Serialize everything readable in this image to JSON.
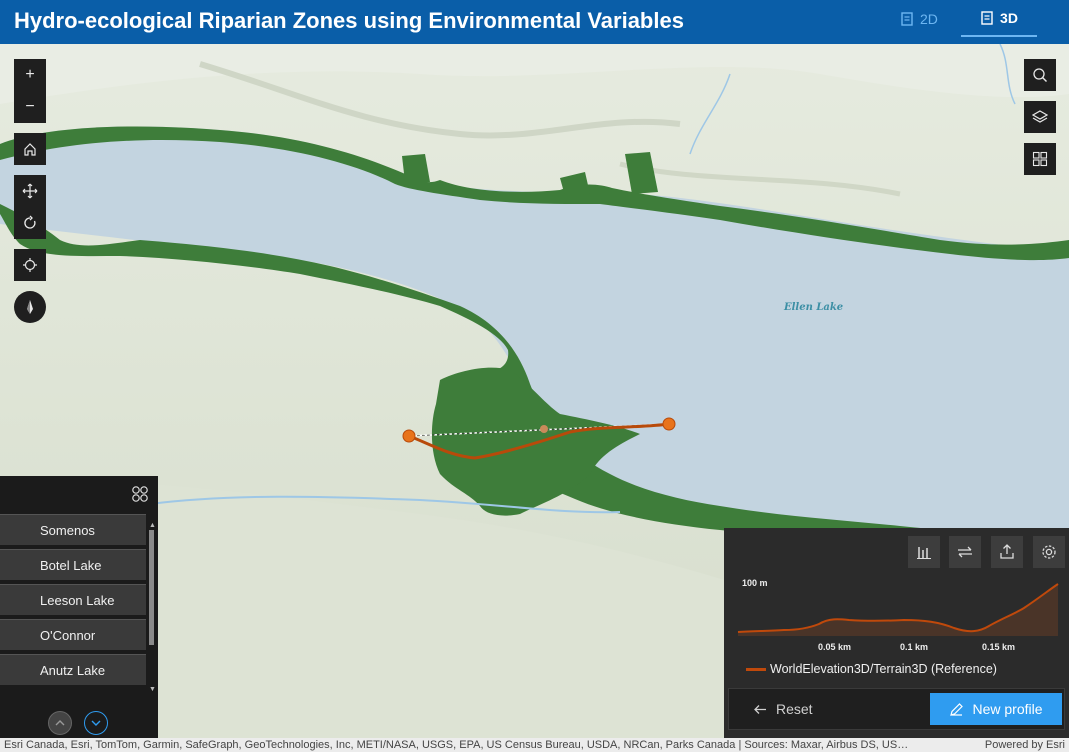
{
  "header": {
    "title": "Hydro-ecological Riparian Zones using Environmental Variables",
    "tabs": [
      {
        "label": "2D",
        "icon": "document-icon",
        "active": false
      },
      {
        "label": "3D",
        "icon": "document-icon",
        "active": true
      }
    ]
  },
  "map": {
    "lake_label": "Ellen Lake",
    "left_tools": [
      "zoom-in-icon",
      "zoom-out-icon",
      "home-icon",
      "pan-icon",
      "rotate-icon",
      "locate-icon",
      "compass-icon"
    ],
    "zoom_in_label": "+",
    "zoom_out_label": "−",
    "right_tools": [
      "search-icon",
      "layers-icon",
      "basemap-gallery-icon"
    ]
  },
  "legend": {
    "items": [
      "Somenos",
      "Botel Lake",
      "Leeson Lake",
      "O'Connor",
      "Anutz Lake"
    ]
  },
  "profile": {
    "tools": [
      "chart-icon",
      "swap-icon",
      "export-icon",
      "settings-icon"
    ],
    "y_label": "100 m",
    "x_labels": [
      "0.05 km",
      "0.1 km",
      "0.15 km"
    ],
    "series_name": "WorldElevation3D/Terrain3D (Reference)",
    "series_color": "#c0490b",
    "reset_label": "Reset",
    "new_profile_label": "New profile"
  },
  "attribution": {
    "credits": "Esri Canada, Esri, TomTom, Garmin, SafeGraph, GeoTechnologies, Inc, METI/NASA, USGS, EPA, US Census Bureau, USDA, NRCan, Parks Canada | Sources: Maxar, Airbus DS, US…",
    "powered": "Powered by Esri"
  },
  "colors": {
    "header_bg": "#0a5ea8",
    "water": "#c3d4e0",
    "land": "#dfe5d6",
    "riparian": "#3e7d3a",
    "accent": "#2f9cf0"
  }
}
